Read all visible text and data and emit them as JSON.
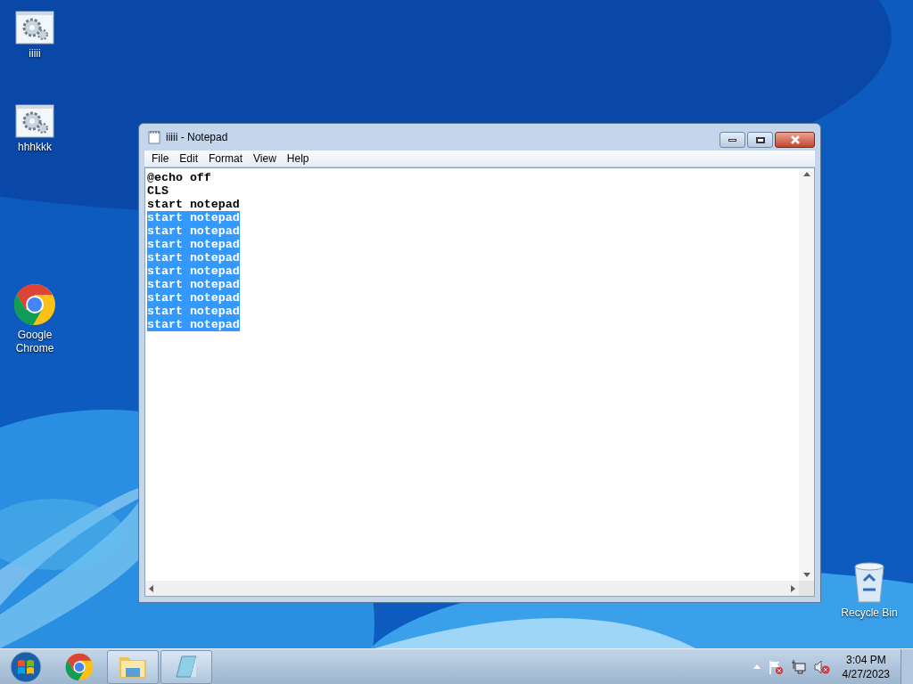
{
  "desktop_icons": [
    {
      "label": "iiiii",
      "kind": "script"
    },
    {
      "label": "hhhkkk",
      "kind": "script"
    },
    {
      "label": "Google Chrome",
      "kind": "chrome"
    },
    {
      "label": "Recycle Bin",
      "kind": "recycle"
    }
  ],
  "window": {
    "title": "iiiii - Notepad",
    "menu": [
      "File",
      "Edit",
      "Format",
      "View",
      "Help"
    ],
    "lines": [
      {
        "text": "@echo off",
        "selected": false
      },
      {
        "text": "CLS",
        "selected": false
      },
      {
        "text": "start notepad",
        "selected": false
      },
      {
        "text": "start notepad",
        "selected": true
      },
      {
        "text": "start notepad",
        "selected": true
      },
      {
        "text": "start notepad",
        "selected": true
      },
      {
        "text": "start notepad",
        "selected": true
      },
      {
        "text": "start notepad",
        "selected": true
      },
      {
        "text": "start notepad",
        "selected": true
      },
      {
        "text": "start notepad",
        "selected": true
      },
      {
        "text": "start notepad",
        "selected": true
      },
      {
        "text": "start notepad",
        "selected": true
      }
    ]
  },
  "taskbar": {
    "buttons": [
      {
        "kind": "start",
        "running": false
      },
      {
        "kind": "chrome",
        "running": false
      },
      {
        "kind": "explorer",
        "running": true
      },
      {
        "kind": "notepad",
        "running": true
      }
    ],
    "clock": {
      "time": "3:04 PM",
      "date": "4/27/2023"
    }
  }
}
